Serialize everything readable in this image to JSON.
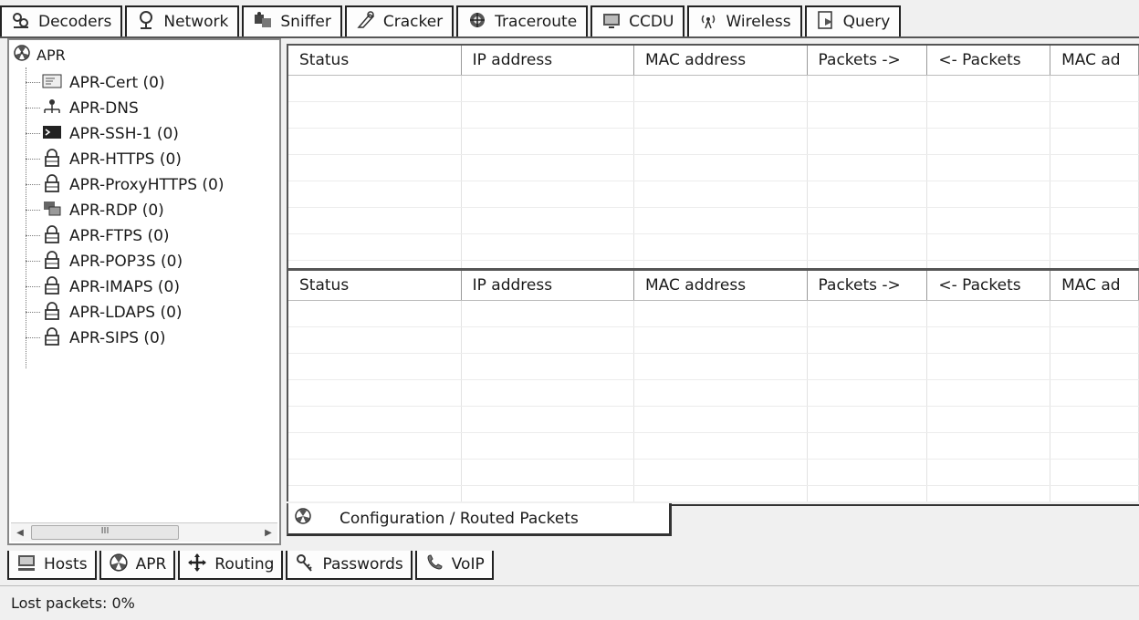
{
  "top_tabs": [
    {
      "label": "Decoders",
      "icon": "decoders-icon"
    },
    {
      "label": "Network",
      "icon": "network-icon"
    },
    {
      "label": "Sniffer",
      "icon": "sniffer-icon"
    },
    {
      "label": "Cracker",
      "icon": "cracker-icon"
    },
    {
      "label": "Traceroute",
      "icon": "traceroute-icon"
    },
    {
      "label": "CCDU",
      "icon": "ccdu-icon"
    },
    {
      "label": "Wireless",
      "icon": "wireless-icon"
    },
    {
      "label": "Query",
      "icon": "query-icon"
    }
  ],
  "tree": {
    "root_label": "APR",
    "items": [
      {
        "label": "APR-Cert (0)",
        "icon": "certificate-icon"
      },
      {
        "label": "APR-DNS",
        "icon": "dns-network-icon"
      },
      {
        "label": "APR-SSH-1 (0)",
        "icon": "terminal-icon"
      },
      {
        "label": "APR-HTTPS (0)",
        "icon": "lock-icon"
      },
      {
        "label": "APR-ProxyHTTPS (0)",
        "icon": "lock-icon"
      },
      {
        "label": "APR-RDP (0)",
        "icon": "remote-desktop-icon"
      },
      {
        "label": "APR-FTPS (0)",
        "icon": "lock-icon"
      },
      {
        "label": "APR-POP3S (0)",
        "icon": "lock-icon"
      },
      {
        "label": "APR-IMAPS (0)",
        "icon": "lock-icon"
      },
      {
        "label": "APR-LDAPS (0)",
        "icon": "lock-icon"
      },
      {
        "label": "APR-SIPS (0)",
        "icon": "lock-icon"
      }
    ],
    "scrollbar_thumb": "III"
  },
  "grid_columns": [
    "Status",
    "IP address",
    "MAC address",
    "Packets ->",
    "<- Packets",
    "MAC ad"
  ],
  "config_tab": {
    "label": "Configuration / Routed Packets",
    "icon": "apr-radiation-icon"
  },
  "bottom_tabs": [
    {
      "label": "Hosts",
      "icon": "hosts-icon"
    },
    {
      "label": "APR",
      "icon": "apr-radiation-icon"
    },
    {
      "label": "Routing",
      "icon": "routing-icon"
    },
    {
      "label": "Passwords",
      "icon": "passwords-icon"
    },
    {
      "label": "VoIP",
      "icon": "voip-icon"
    }
  ],
  "status": {
    "text": "Lost packets:  0%"
  }
}
